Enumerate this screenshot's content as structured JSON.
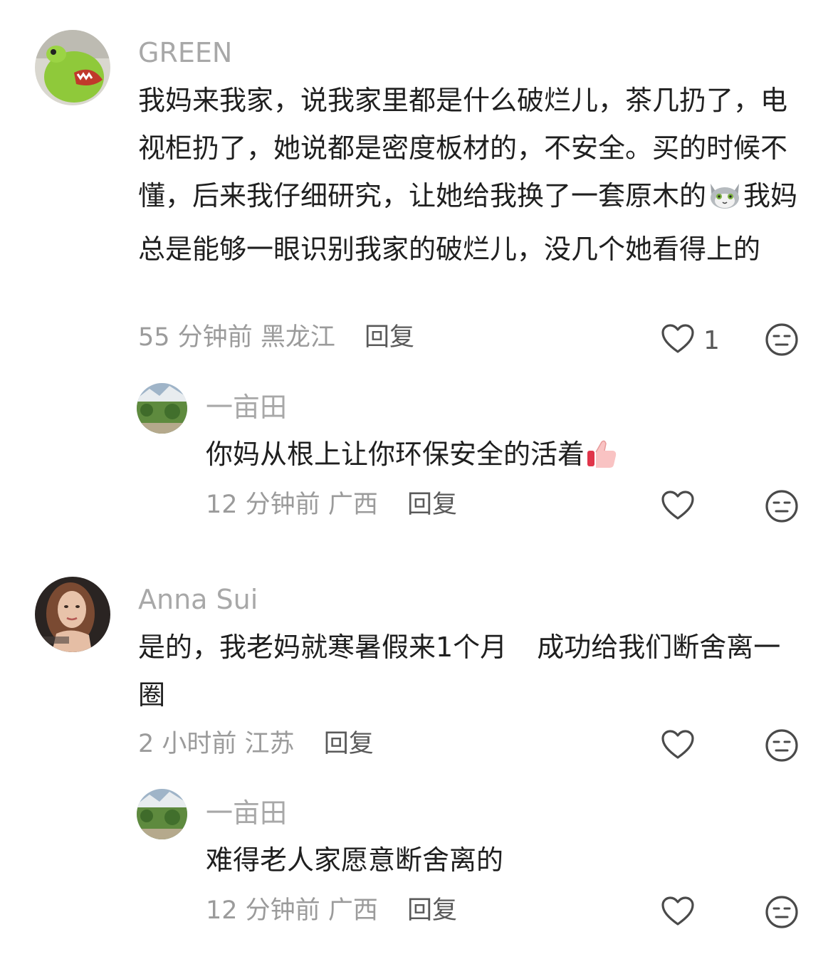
{
  "comments": [
    {
      "username": "GREEN",
      "text_part1": "我妈来我家，说我家里都是什么破烂儿，茶几扔了，电视柜扔了，她说都是密度板材的，不安全。买的时候不懂，后来我仔细研究，让她给我换了一套原木的",
      "emoji1": "cat-face-emoji",
      "text_part2": "我妈总是能够一眼识别我家的破烂儿，没几个她看得上的",
      "time": "55 分钟前",
      "location": "黑龙江",
      "reply_label": "回复",
      "likes": "1",
      "reply": {
        "username": "一亩田",
        "text": "你妈从根上让你环保安全的活着",
        "emoji": "thumbs-up-emoji",
        "time": "12 分钟前",
        "location": "广西",
        "reply_label": "回复"
      }
    },
    {
      "username": "Anna Sui",
      "text_part1": "是的，我老妈就寒暑假来1个月",
      "text_part2": "成功给我们断舍离一圈",
      "time": "2 小时前",
      "location": "江苏",
      "reply_label": "回复",
      "reply": {
        "username": "一亩田",
        "text": "难得老人家愿意断舍离的",
        "time": "12 分钟前",
        "location": "广西",
        "reply_label": "回复"
      }
    }
  ],
  "icons": {
    "like": "heart-outline-icon",
    "dislike": "neutral-face-icon"
  }
}
